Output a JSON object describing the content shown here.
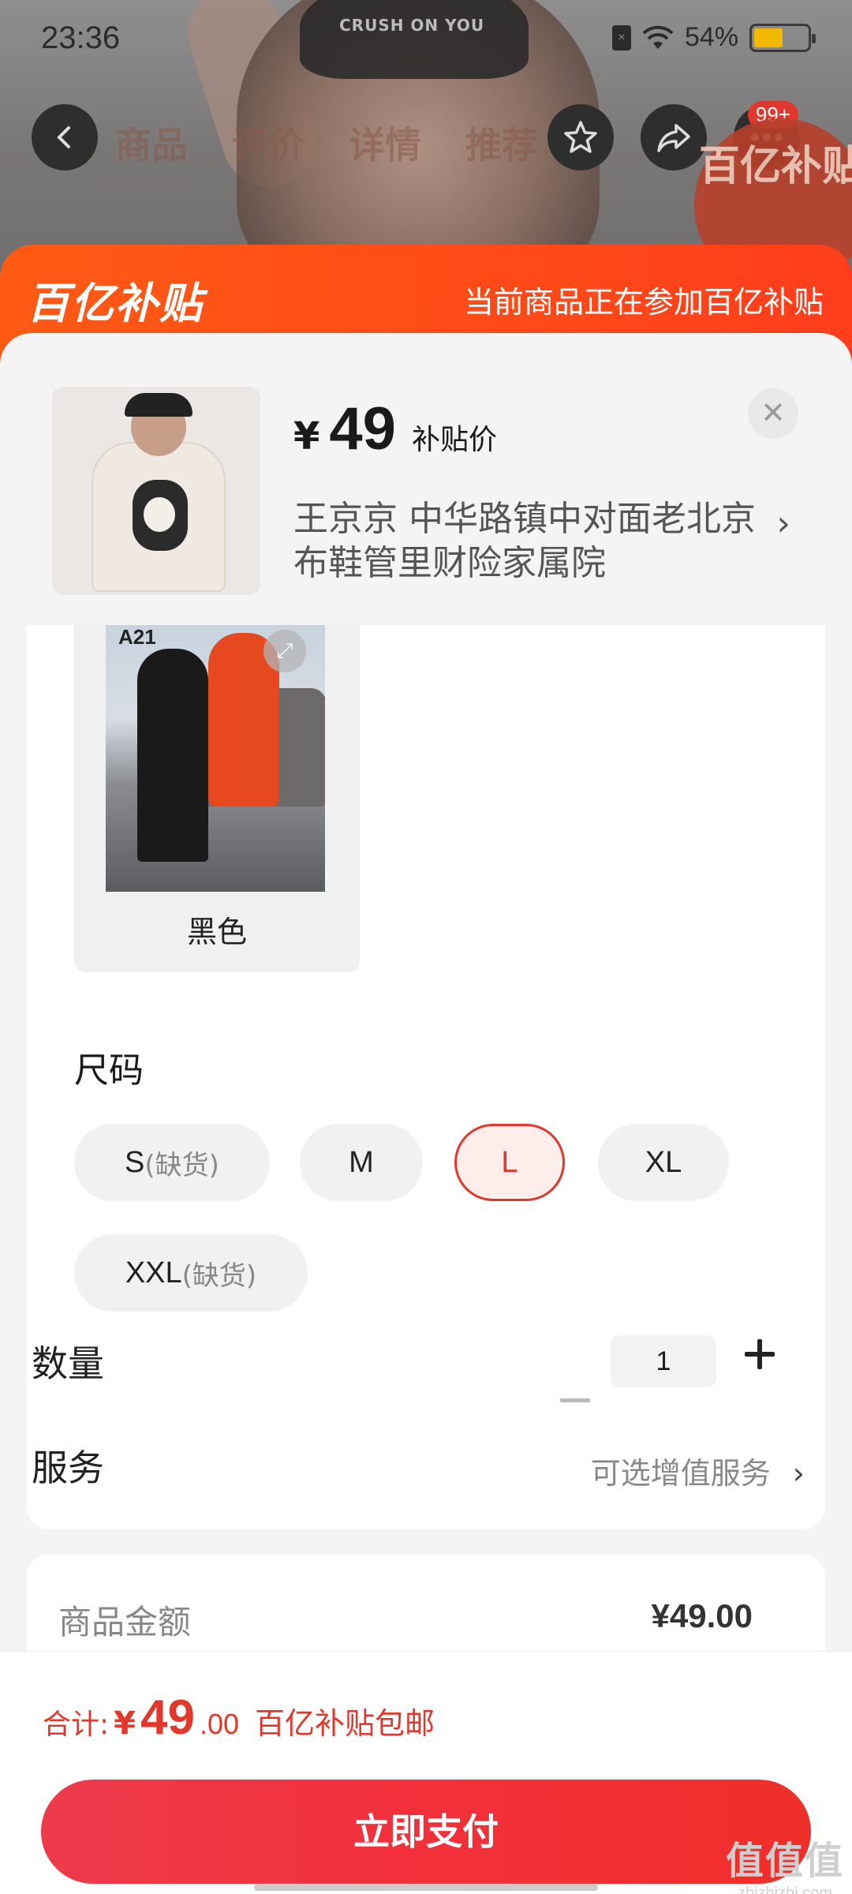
{
  "status": {
    "time": "23:36",
    "battery_percent": "54%",
    "battery_level": 0.54
  },
  "nav": {
    "tabs": [
      "商品",
      "评价",
      "详情",
      "推荐"
    ],
    "cart_badge": "99+",
    "bg_tag": "百亿补贴"
  },
  "banner": {
    "logo": "百亿补贴",
    "note": "当前商品正在参加百亿补贴"
  },
  "product": {
    "currency": "¥",
    "price": "49",
    "price_tag": "补贴价",
    "address": "王京京  中华路镇中对面老北京布鞋管里财险家属院"
  },
  "color": {
    "label_badge": "A21",
    "name": "黑色"
  },
  "size": {
    "title": "尺码",
    "options": [
      {
        "label": "S",
        "note": "(缺货)"
      },
      {
        "label": "M",
        "note": ""
      },
      {
        "label": "L",
        "note": ""
      },
      {
        "label": "XL",
        "note": ""
      },
      {
        "label": "XXL",
        "note": "(缺货)"
      }
    ],
    "selected": "L"
  },
  "quantity": {
    "label": "数量",
    "value": "1"
  },
  "service": {
    "label": "服务",
    "value": "可选增值服务"
  },
  "amount": {
    "label": "商品金额",
    "value": "¥49.00"
  },
  "total": {
    "prefix": "合计:",
    "currency": "¥",
    "integer": "49",
    "decimal": ".00",
    "shipping": "百亿补贴包邮"
  },
  "pay_button": "立即支付",
  "watermark": {
    "big": "值值值",
    "small": "zhizhizhi.com"
  },
  "colors": {
    "accent": "#e2382c",
    "banner": "#ff4a18"
  }
}
